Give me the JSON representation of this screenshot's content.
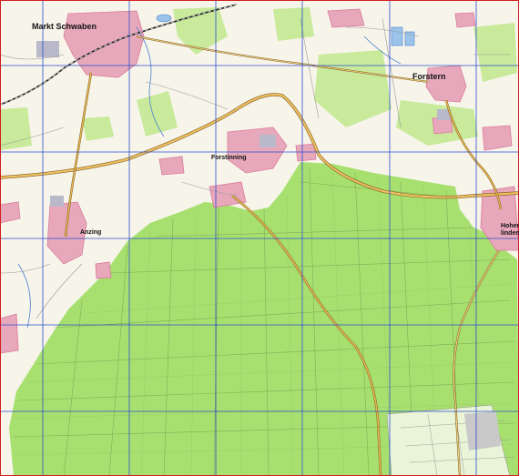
{
  "map": {
    "towns": [
      {
        "id": "markt-schwaben",
        "name": "Markt Schwaben"
      },
      {
        "id": "forstern",
        "name": "Forstern"
      },
      {
        "id": "forstinning",
        "name": "Forstinning"
      },
      {
        "id": "anzing",
        "name": "Anzing"
      },
      {
        "id": "hohenlinden",
        "name_line1": "Hohen-",
        "name_line2": "linden"
      }
    ],
    "colors": {
      "background": "#f7f4ea",
      "forest": "#a8e070",
      "forest_dark": "#8fd05a",
      "settlement": "#d97a9a",
      "settlement_fill": "#e8a8bc",
      "main_road": "#c9932a",
      "road_outline": "#7a5a20",
      "water": "#4a7fd0",
      "grid_line": "#2a4fcf",
      "field_line": "#8a8a8a"
    }
  }
}
